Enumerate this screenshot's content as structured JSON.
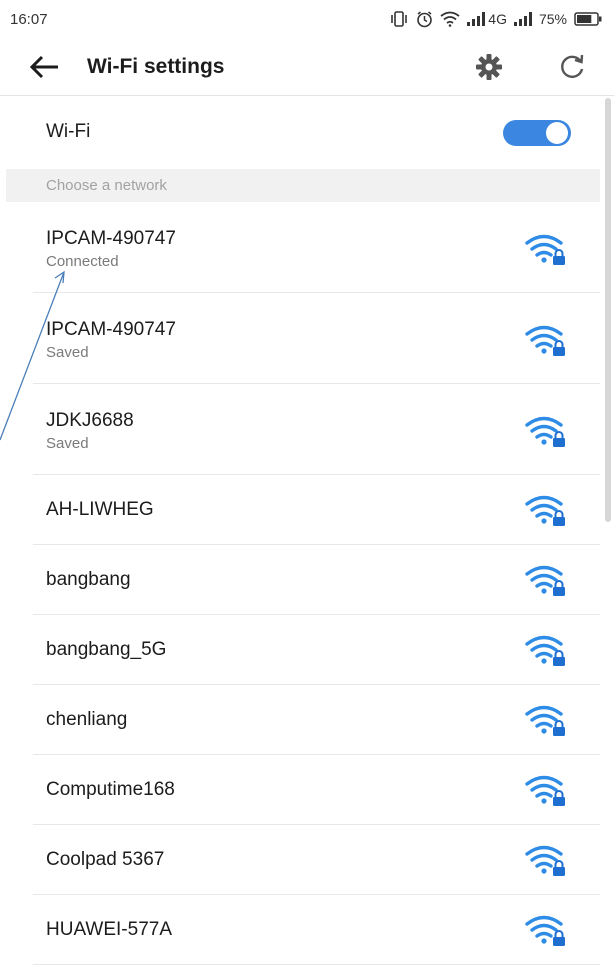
{
  "status_bar": {
    "time": "16:07",
    "network_type": "4G",
    "battery": "75%",
    "battery_level": 0.75
  },
  "toolbar": {
    "title": "Wi-Fi settings",
    "back_icon": "back-arrow-icon",
    "settings_icon": "gear-icon",
    "refresh_icon": "refresh-icon"
  },
  "wifi_toggle": {
    "label": "Wi-Fi",
    "enabled": true,
    "accent_color": "#3a86e0"
  },
  "section": {
    "label": "Choose a network"
  },
  "networks": [
    {
      "name": "IPCAM-490747",
      "status": "Connected",
      "secured": true
    },
    {
      "name": "IPCAM-490747",
      "status": "Saved",
      "secured": true
    },
    {
      "name": "JDKJ6688",
      "status": "Saved",
      "secured": true
    },
    {
      "name": "AH-LIWHEG",
      "status": "",
      "secured": true
    },
    {
      "name": "bangbang",
      "status": "",
      "secured": true
    },
    {
      "name": "bangbang_5G",
      "status": "",
      "secured": true
    },
    {
      "name": "chenliang",
      "status": "",
      "secured": true
    },
    {
      "name": "Computime168",
      "status": "",
      "secured": true
    },
    {
      "name": "Coolpad 5367",
      "status": "",
      "secured": true
    },
    {
      "name": "HUAWEI-577A",
      "status": "",
      "secured": true
    }
  ],
  "colors": {
    "wifi_icon": "#2f8ce6",
    "lock": "#1f6fd1"
  }
}
